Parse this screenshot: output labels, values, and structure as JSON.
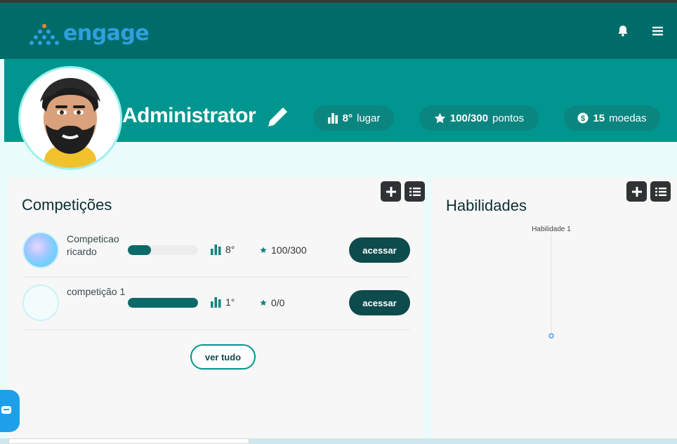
{
  "header": {
    "logo_text": "engage",
    "logo_icon": "dots-triangle-logo",
    "notification_icon": "bell-icon",
    "menu_icon": "hamburger-menu-icon"
  },
  "profile": {
    "name": "Administrator",
    "edit_icon": "pencil-icon",
    "stats": {
      "rank_value": "8°",
      "rank_label": "lugar",
      "points_value": "100/300",
      "points_label": "pontos",
      "coins_value": "15",
      "coins_label": "moedas"
    }
  },
  "competitions": {
    "title": "Competições",
    "add_icon": "plus-icon",
    "list_icon": "list-icon",
    "items": [
      {
        "name": "Competicao ricardo",
        "progress": 0.33,
        "rank": "8°",
        "points": "100/300",
        "action": "acessar"
      },
      {
        "name": "competição 1",
        "progress": 1.0,
        "rank": "1°",
        "points": "0/0",
        "action": "acessar"
      }
    ],
    "see_all": "ver tudo"
  },
  "skills": {
    "title": "Habilidades",
    "add_icon": "plus-icon",
    "list_icon": "list-icon",
    "chart_data": {
      "type": "radar",
      "categories": [
        "Habilidade 1"
      ],
      "values": [
        0
      ]
    }
  },
  "colors": {
    "header": "#006c6a",
    "banner": "#00968f",
    "dark_button": "#0d4b4d",
    "logo": "#2f9fe0"
  }
}
